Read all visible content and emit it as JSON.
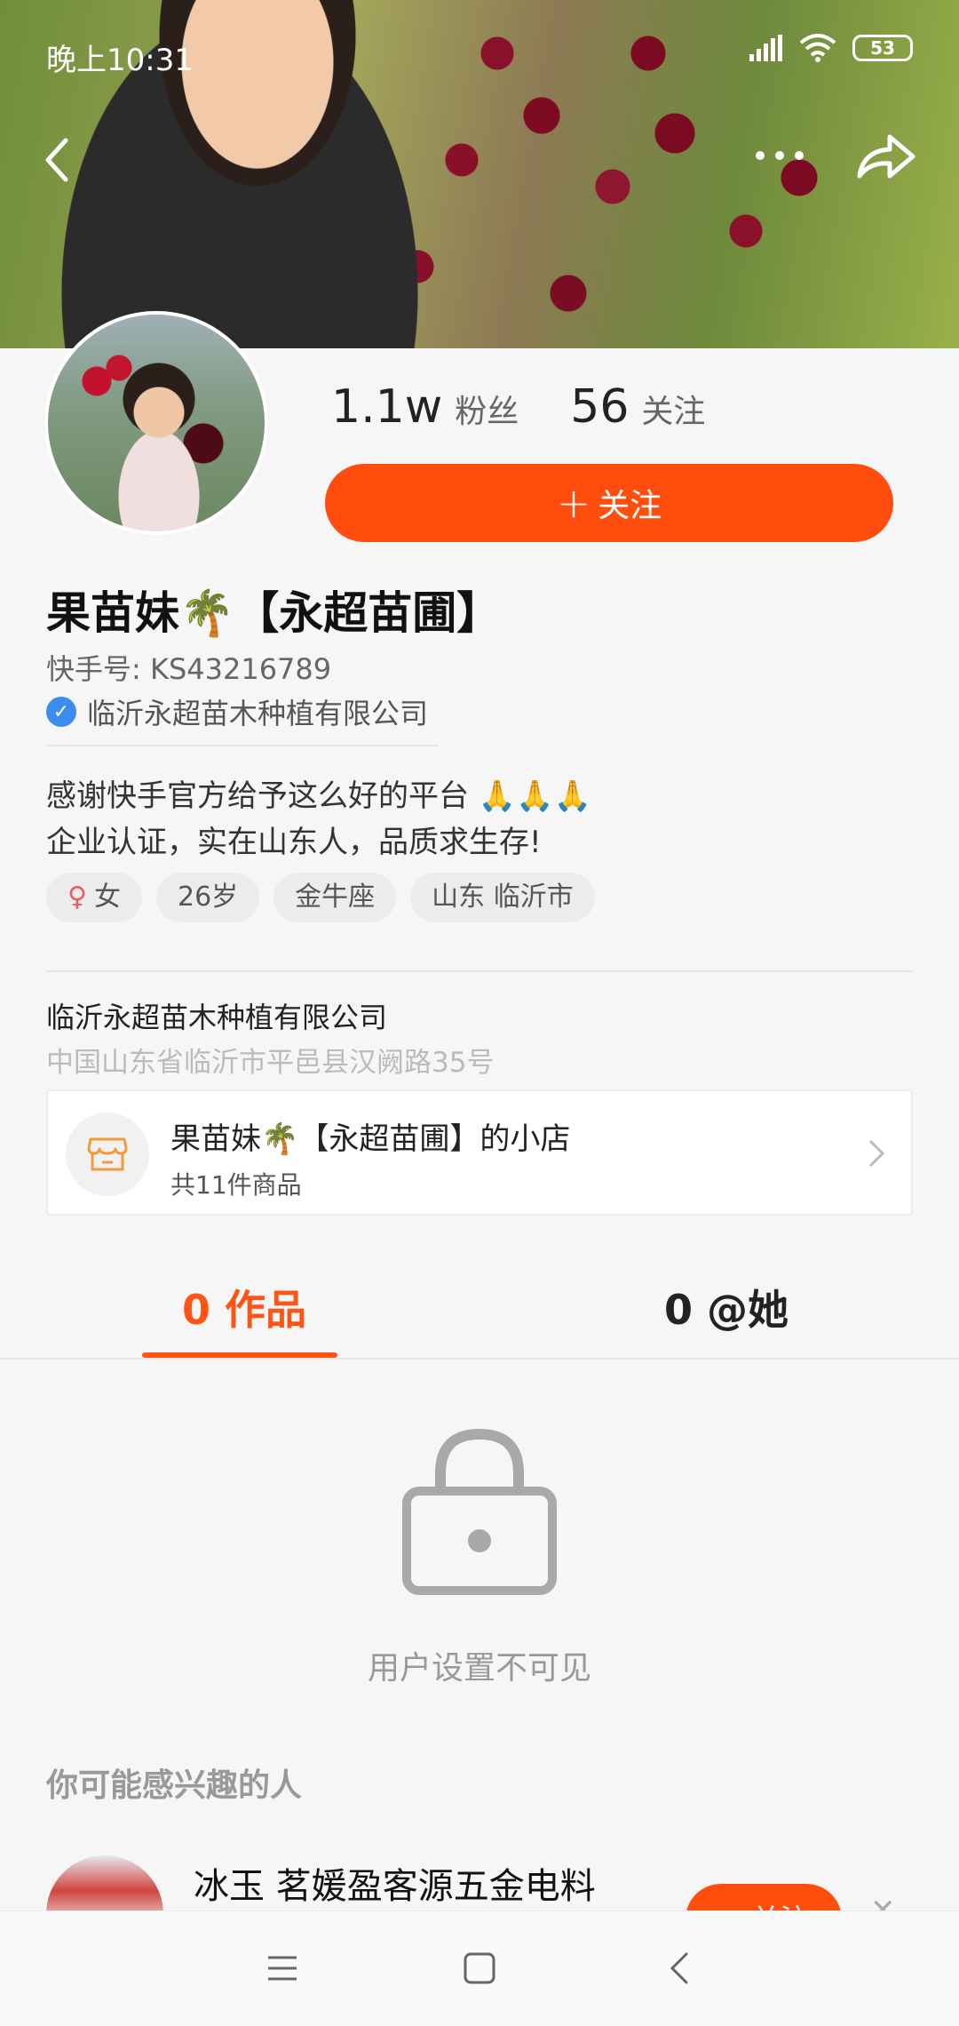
{
  "status_bar": {
    "time": "晚上10:31",
    "battery": "53"
  },
  "profile": {
    "fans_count": "1.1w",
    "fans_label": "粉丝",
    "following_count": "56",
    "following_label": "关注",
    "follow_button": "关注",
    "name": "果苗妹🌴【永超苗圃】",
    "kuaishou_id": "快手号: KS43216789",
    "verified_company": "临沂永超苗木种植有限公司",
    "bio_line1": "感谢快手官方给予这么好的平台 🙏🙏🙏",
    "bio_line2": "企业认证，实在山东人，品质求生存!",
    "tags": {
      "gender": "女",
      "age": "26岁",
      "zodiac": "金牛座",
      "location": "山东 临沂市"
    },
    "address_title": "临沂永超苗木种植有限公司",
    "address": "中国山东省临沂市平邑县汉阙路35号"
  },
  "shop": {
    "name": "果苗妹🌴【永超苗圃】的小店",
    "count": "共11件商品"
  },
  "tabs": {
    "works": "0 作品",
    "at": "0 @她"
  },
  "empty_state": {
    "text": "用户设置不可见"
  },
  "suggestions": {
    "title": "你可能感兴趣的人",
    "items": [
      {
        "name": "冰玉 茗媛盈客源五金电料",
        "follow": "+ 关注"
      }
    ]
  },
  "colors": {
    "accent": "#ff4d0d",
    "verify": "#3a8cf0"
  }
}
